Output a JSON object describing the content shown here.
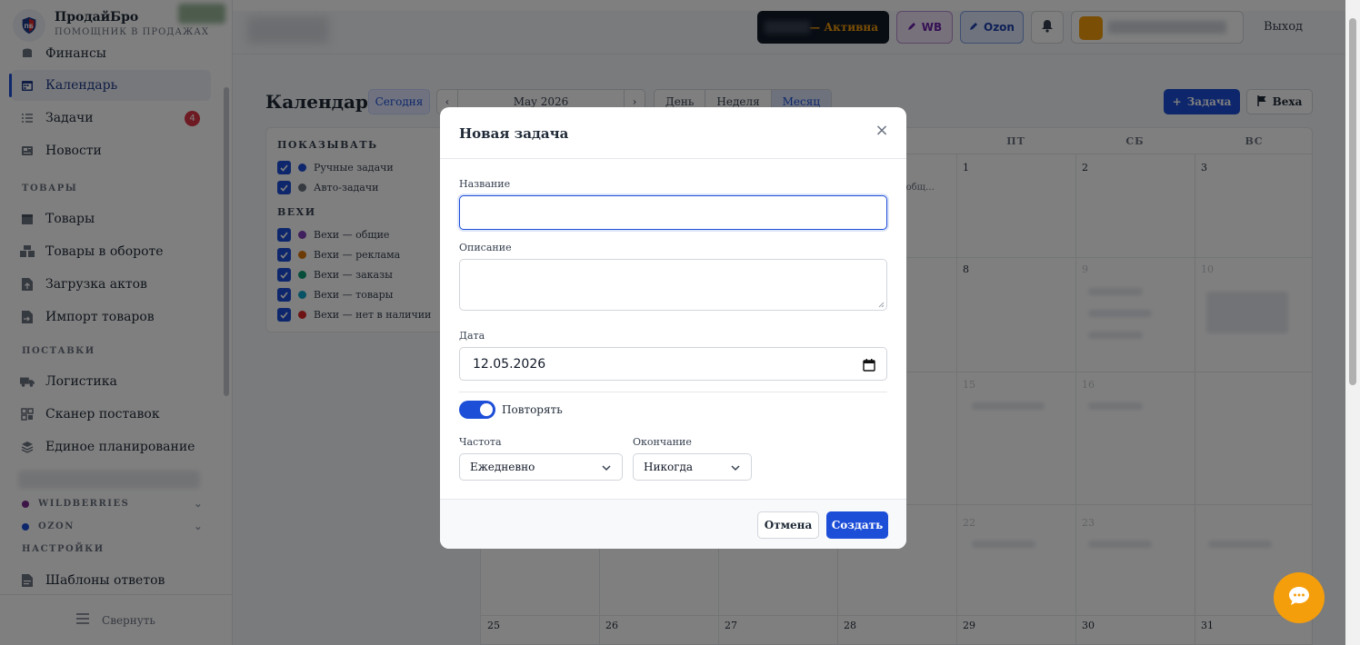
{
  "brand": {
    "name": "ПродайБро",
    "subtitle": "ПОМОЩНИК В ПРОДАЖАХ"
  },
  "sidebar": {
    "items": [
      {
        "label": "Финансы",
        "icon": "finance-icon"
      },
      {
        "label": "Календарь",
        "icon": "calendar-icon",
        "active": true
      },
      {
        "label": "Задачи",
        "icon": "tasks-icon",
        "badge": "4"
      },
      {
        "label": "Новости",
        "icon": "news-icon"
      }
    ],
    "section_goods": "ТОВАРЫ",
    "goods_items": [
      {
        "label": "Товары",
        "icon": "box-icon"
      },
      {
        "label": "Товары в обороте",
        "icon": "boxes-icon"
      },
      {
        "label": "Загрузка актов",
        "icon": "file-upload-icon"
      },
      {
        "label": "Импорт товаров",
        "icon": "file-import-icon"
      }
    ],
    "section_supplies": "ПОСТАВКИ",
    "supplies_items": [
      {
        "label": "Логистика",
        "icon": "truck-icon"
      },
      {
        "label": "Сканер поставок",
        "icon": "grid-icon"
      },
      {
        "label": "Единое планирование",
        "icon": "layers-icon"
      }
    ],
    "marketplaces": [
      {
        "label": "WILDBERRIES",
        "color": "#7b2d8e"
      },
      {
        "label": "OZON",
        "color": "#1d4ed8"
      }
    ],
    "section_settings": "НАСТРОЙКИ",
    "settings_items": [
      {
        "label": "Шаблоны ответов",
        "icon": "template-icon"
      }
    ],
    "collapse_label": "Свернуть"
  },
  "header": {
    "subscription_label": "— Активна",
    "wb_label": "WB",
    "ozon_label": "Ozon",
    "logout_label": "Выход"
  },
  "calendar": {
    "title": "Календарь",
    "today": "Сегодня",
    "month": "May 2026",
    "views": [
      "День",
      "Неделя",
      "Месяц"
    ],
    "active_view": "Месяц",
    "add_task": "Задача",
    "add_milestone": "Веха",
    "weekdays": [
      "ПТ",
      "СБ",
      "ВС"
    ],
    "filters": {
      "show_header": "ПОКАЗЫВАТЬ",
      "show_items": [
        {
          "label": "Ручные задачи",
          "color": "#1d4ed8"
        },
        {
          "label": "Авто-задачи",
          "color": "#6b7280"
        }
      ],
      "milestones_header": "ВЕХИ",
      "milestone_items": [
        {
          "label": "Вехи — общие",
          "color": "#7e3fb8"
        },
        {
          "label": "Вехи — реклама",
          "color": "#d97706"
        },
        {
          "label": "Вехи — заказы",
          "color": "#0f9d75"
        },
        {
          "label": "Вехи — товары",
          "color": "#0ea5c9"
        },
        {
          "label": "Вехи — нет в наличии",
          "color": "#dc2626"
        }
      ]
    },
    "days": {
      "row1": [
        "1",
        "2",
        "3"
      ],
      "row2": [
        "8",
        "9",
        "10"
      ],
      "row3": [
        "15",
        "16"
      ],
      "row4": [
        "22",
        "23"
      ],
      "row5": [
        "25",
        "26",
        "27",
        "28",
        "29",
        "30",
        "31"
      ]
    },
    "event_snippet": "сообщ…"
  },
  "modal": {
    "title": "Новая задача",
    "name_label": "Название",
    "name_value": "",
    "description_label": "Описание",
    "date_label": "Дата",
    "date_value": "12.05.2026",
    "repeat_label": "Повторять",
    "repeat_on": true,
    "frequency_label": "Частота",
    "frequency_value": "Ежедневно",
    "end_label": "Окончание",
    "end_value": "Никогда",
    "cancel": "Отмена",
    "create": "Создать"
  }
}
